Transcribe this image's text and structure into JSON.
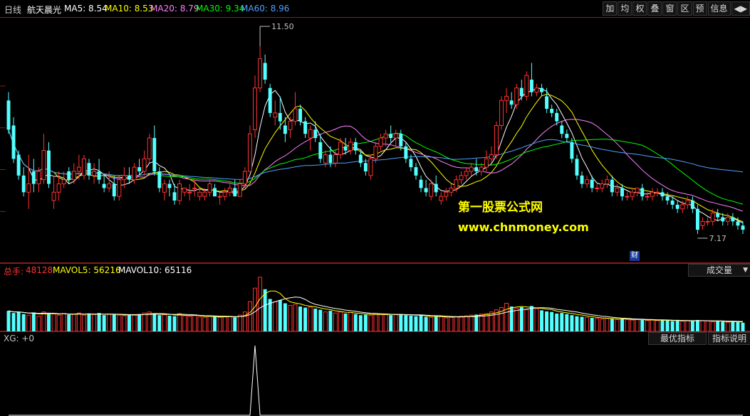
{
  "header": {
    "period": "日线",
    "name": "航天晨光",
    "ma": [
      {
        "label": "MA5: 8.54",
        "color": "#ffffff"
      },
      {
        "label": "MA10: 8.53",
        "color": "#ffff00"
      },
      {
        "label": "MA20: 8.79",
        "color": "#ff80ff"
      },
      {
        "label": "MA30: 9.34",
        "color": "#00ff00"
      },
      {
        "label": "MA60: 8.96",
        "color": "#50a0ff"
      }
    ]
  },
  "toolbar": [
    "加",
    "均",
    "权",
    "叠",
    "窗",
    "区",
    "预",
    "信息",
    "◀▶"
  ],
  "watermark": {
    "line1": "第一股票公式网",
    "line2": "www.chnmoney.com"
  },
  "badge": "财",
  "volume_header": {
    "total_label": "总手:",
    "total_value": "48128",
    "mavol5": "MAVOL5: 56216",
    "mavol10": "MAVOL10: 65116",
    "dropdown": "成交量"
  },
  "xg_header": {
    "label": "XG: +0",
    "btn1": "最优指标",
    "btn2": "指标说明"
  },
  "colors": {
    "up": "#ff3232",
    "down": "#54ffff",
    "grid": "#8b1a1a"
  },
  "chart_data": {
    "type": "candlestick",
    "price_axis": [
      6.3,
      12.2
    ],
    "annotations": {
      "high": "11.50",
      "low": "7.17"
    },
    "candles": [
      [
        10.2,
        10.4,
        9.4,
        9.5
      ],
      [
        9.6,
        9.8,
        8.7,
        8.8
      ],
      [
        8.9,
        9.0,
        8.3,
        8.4
      ],
      [
        8.4,
        8.6,
        7.9,
        8.0
      ],
      [
        8.0,
        8.9,
        7.6,
        8.2
      ],
      [
        8.5,
        8.8,
        8.0,
        8.2
      ],
      [
        8.2,
        8.6,
        8.0,
        8.5
      ],
      [
        8.3,
        9.4,
        8.2,
        9.0
      ],
      [
        9.0,
        9.2,
        8.1,
        8.2
      ],
      [
        7.8,
        8.4,
        7.6,
        8.0
      ],
      [
        8.0,
        8.5,
        7.8,
        8.2
      ],
      [
        8.2,
        8.5,
        8.1,
        8.3
      ],
      [
        8.5,
        8.6,
        8.2,
        8.3
      ],
      [
        8.3,
        8.7,
        8.2,
        8.5
      ],
      [
        8.5,
        8.9,
        8.3,
        8.6
      ],
      [
        8.4,
        8.9,
        8.3,
        8.8
      ],
      [
        8.7,
        8.8,
        8.3,
        8.4
      ],
      [
        8.4,
        8.7,
        8.2,
        8.5
      ],
      [
        8.5,
        8.8,
        8.2,
        8.3
      ],
      [
        8.2,
        8.4,
        8.0,
        8.1
      ],
      [
        8.1,
        8.5,
        8.0,
        8.2
      ],
      [
        8.2,
        8.4,
        7.8,
        7.9
      ],
      [
        7.9,
        8.4,
        7.8,
        8.3
      ],
      [
        8.3,
        8.6,
        8.1,
        8.4
      ],
      [
        8.4,
        8.6,
        8.2,
        8.3
      ],
      [
        8.3,
        8.7,
        8.2,
        8.6
      ],
      [
        8.6,
        8.8,
        8.4,
        8.5
      ],
      [
        8.5,
        9.0,
        8.4,
        8.8
      ],
      [
        8.8,
        9.4,
        8.7,
        9.3
      ],
      [
        9.3,
        9.6,
        8.4,
        8.5
      ],
      [
        8.5,
        8.6,
        8.0,
        8.1
      ],
      [
        8.0,
        8.3,
        7.8,
        8.2
      ],
      [
        8.2,
        8.3,
        7.9,
        8.1
      ],
      [
        8.0,
        8.2,
        7.7,
        7.8
      ],
      [
        7.8,
        8.3,
        7.7,
        8.2
      ],
      [
        8.0,
        8.1,
        7.9,
        8.1
      ],
      [
        8.0,
        8.2,
        7.8,
        8.0
      ],
      [
        8.1,
        8.3,
        7.9,
        8.1
      ],
      [
        7.9,
        8.1,
        7.8,
        8.0
      ],
      [
        7.9,
        8.1,
        7.8,
        8.0
      ],
      [
        8.0,
        8.3,
        7.9,
        8.2
      ],
      [
        8.1,
        8.2,
        7.9,
        7.9
      ],
      [
        7.9,
        8.0,
        7.7,
        7.9
      ],
      [
        7.9,
        8.1,
        7.8,
        8.0
      ],
      [
        8.0,
        8.2,
        7.9,
        8.1
      ],
      [
        8.1,
        8.3,
        7.9,
        7.9
      ],
      [
        7.9,
        8.3,
        7.9,
        8.2
      ],
      [
        8.2,
        8.6,
        8.1,
        8.5
      ],
      [
        8.5,
        9.6,
        8.5,
        9.4
      ],
      [
        9.5,
        10.8,
        9.3,
        10.5
      ],
      [
        10.5,
        11.5,
        10.4,
        11.2
      ],
      [
        11.1,
        11.3,
        10.6,
        10.7
      ],
      [
        10.5,
        10.6,
        9.8,
        9.9
      ],
      [
        9.8,
        10.2,
        9.6,
        9.9
      ],
      [
        9.9,
        10.3,
        9.5,
        9.7
      ],
      [
        9.6,
        9.8,
        9.2,
        9.4
      ],
      [
        9.5,
        9.8,
        9.3,
        9.7
      ],
      [
        9.7,
        10.4,
        9.6,
        10.0
      ],
      [
        10.0,
        10.1,
        9.6,
        9.7
      ],
      [
        9.7,
        9.8,
        9.3,
        9.4
      ],
      [
        9.3,
        9.6,
        9.0,
        9.5
      ],
      [
        9.5,
        9.7,
        9.2,
        9.3
      ],
      [
        9.2,
        9.4,
        8.7,
        8.8
      ],
      [
        8.7,
        9.0,
        8.6,
        8.9
      ],
      [
        8.9,
        9.1,
        8.6,
        8.7
      ],
      [
        8.7,
        9.0,
        8.6,
        8.9
      ],
      [
        8.9,
        9.3,
        8.8,
        9.2
      ],
      [
        9.1,
        9.3,
        8.9,
        9.0
      ],
      [
        9.0,
        9.3,
        8.9,
        9.2
      ],
      [
        9.2,
        9.3,
        8.9,
        9.0
      ],
      [
        8.9,
        9.0,
        8.6,
        8.7
      ],
      [
        8.7,
        8.8,
        8.4,
        8.5
      ],
      [
        8.4,
        8.9,
        8.3,
        8.8
      ],
      [
        8.8,
        9.2,
        8.7,
        9.1
      ],
      [
        9.1,
        9.4,
        9.0,
        9.3
      ],
      [
        9.3,
        9.5,
        9.1,
        9.4
      ],
      [
        9.4,
        9.6,
        9.2,
        9.3
      ],
      [
        9.3,
        9.5,
        9.1,
        9.4
      ],
      [
        9.4,
        9.5,
        9.0,
        9.1
      ],
      [
        9.1,
        9.2,
        8.7,
        8.8
      ],
      [
        8.8,
        8.9,
        8.5,
        8.6
      ],
      [
        8.6,
        8.7,
        8.3,
        8.4
      ],
      [
        8.3,
        8.4,
        8.0,
        8.1
      ],
      [
        8.1,
        8.3,
        7.9,
        8.0
      ],
      [
        7.9,
        8.3,
        7.8,
        8.2
      ],
      [
        8.2,
        8.4,
        7.9,
        8.0
      ],
      [
        7.8,
        8.0,
        7.7,
        7.9
      ],
      [
        7.9,
        8.1,
        7.8,
        8.0
      ],
      [
        8.0,
        8.2,
        7.9,
        8.1
      ],
      [
        8.1,
        8.4,
        8.0,
        8.3
      ],
      [
        8.3,
        8.5,
        8.2,
        8.4
      ],
      [
        8.4,
        8.6,
        8.3,
        8.5
      ],
      [
        8.5,
        8.7,
        8.4,
        8.6
      ],
      [
        8.6,
        8.8,
        8.4,
        8.5
      ],
      [
        8.5,
        8.7,
        8.4,
        8.6
      ],
      [
        8.6,
        9.0,
        8.5,
        8.8
      ],
      [
        8.8,
        9.1,
        8.7,
        8.9
      ],
      [
        8.9,
        9.7,
        8.8,
        9.6
      ],
      [
        9.6,
        10.3,
        9.5,
        10.2
      ],
      [
        10.2,
        10.5,
        9.9,
        10.3
      ],
      [
        10.2,
        10.4,
        10.0,
        10.1
      ],
      [
        10.1,
        10.6,
        10.0,
        10.5
      ],
      [
        10.5,
        10.7,
        10.2,
        10.3
      ],
      [
        10.3,
        10.9,
        10.2,
        10.8
      ],
      [
        10.7,
        11.1,
        10.3,
        10.4
      ],
      [
        10.4,
        10.6,
        10.3,
        10.5
      ],
      [
        10.5,
        10.6,
        10.3,
        10.4
      ],
      [
        10.3,
        10.5,
        9.9,
        10.0
      ],
      [
        10.0,
        10.1,
        9.8,
        9.9
      ],
      [
        9.9,
        10.0,
        9.6,
        9.7
      ],
      [
        9.6,
        9.7,
        9.3,
        9.4
      ],
      [
        9.4,
        9.5,
        9.2,
        9.3
      ],
      [
        9.2,
        9.3,
        8.7,
        8.8
      ],
      [
        8.8,
        8.9,
        8.3,
        8.4
      ],
      [
        8.4,
        8.5,
        8.1,
        8.2
      ],
      [
        8.2,
        8.4,
        8.1,
        8.3
      ],
      [
        8.3,
        8.4,
        8.0,
        8.1
      ],
      [
        8.1,
        8.2,
        8.0,
        8.1
      ],
      [
        8.1,
        8.3,
        8.0,
        8.2
      ],
      [
        8.2,
        8.4,
        8.1,
        8.3
      ],
      [
        8.3,
        8.4,
        7.9,
        8.0
      ],
      [
        8.0,
        8.2,
        7.9,
        8.1
      ],
      [
        8.1,
        8.2,
        7.8,
        7.9
      ],
      [
        7.9,
        8.0,
        7.8,
        7.9
      ],
      [
        7.9,
        8.1,
        7.8,
        8.0
      ],
      [
        8.0,
        8.1,
        7.9,
        8.1
      ],
      [
        8.1,
        8.2,
        7.8,
        7.9
      ],
      [
        7.9,
        8.0,
        7.8,
        7.9
      ],
      [
        7.9,
        8.1,
        7.8,
        8.0
      ],
      [
        8.0,
        8.1,
        7.9,
        8.0
      ],
      [
        8.0,
        8.1,
        7.8,
        7.9
      ],
      [
        7.9,
        8.0,
        7.7,
        7.8
      ],
      [
        7.8,
        7.9,
        7.6,
        7.7
      ],
      [
        7.7,
        7.8,
        7.5,
        7.6
      ],
      [
        7.6,
        7.8,
        7.5,
        7.7
      ],
      [
        7.7,
        7.9,
        7.6,
        7.8
      ],
      [
        7.8,
        7.9,
        7.5,
        7.6
      ],
      [
        7.6,
        7.7,
        7.0,
        7.1
      ],
      [
        7.2,
        7.4,
        7.1,
        7.3
      ],
      [
        7.3,
        7.4,
        7.2,
        7.3
      ],
      [
        7.3,
        7.6,
        7.2,
        7.5
      ],
      [
        7.5,
        7.6,
        7.3,
        7.4
      ],
      [
        7.4,
        7.5,
        7.2,
        7.3
      ],
      [
        7.3,
        7.5,
        7.2,
        7.4
      ],
      [
        7.4,
        7.5,
        7.2,
        7.3
      ],
      [
        7.3,
        7.4,
        7.1,
        7.2
      ],
      [
        7.2,
        7.3,
        7.0,
        7.1
      ]
    ],
    "volume": [
      38,
      34,
      36,
      32,
      30,
      35,
      28,
      36,
      34,
      32,
      30,
      33,
      31,
      32,
      34,
      30,
      33,
      31,
      34,
      30,
      32,
      31,
      30,
      29,
      31,
      30,
      32,
      34,
      36,
      33,
      30,
      31,
      29,
      28,
      33,
      29,
      28,
      30,
      27,
      26,
      28,
      27,
      26,
      27,
      28,
      26,
      30,
      36,
      55,
      80,
      100,
      78,
      60,
      55,
      58,
      52,
      48,
      50,
      46,
      44,
      45,
      42,
      40,
      36,
      38,
      34,
      36,
      33,
      35,
      32,
      30,
      31,
      30,
      33,
      32,
      31,
      30,
      31,
      32,
      30,
      29,
      28,
      30,
      27,
      26,
      28,
      27,
      25,
      26,
      27,
      28,
      29,
      30,
      31,
      32,
      33,
      36,
      40,
      44,
      52,
      46,
      43,
      45,
      40,
      47,
      42,
      39,
      37,
      36,
      33,
      34,
      32,
      30,
      28,
      27,
      26,
      25,
      24,
      23,
      24,
      23,
      22,
      23,
      22,
      21,
      22,
      21,
      20,
      21,
      20,
      21,
      20,
      19,
      20,
      19,
      20,
      19,
      21,
      20,
      19,
      18,
      19,
      18,
      17,
      18,
      17,
      16
    ],
    "volume_axis": [
      0,
      100
    ],
    "xg": {
      "spike_index": 49,
      "value": 1
    }
  }
}
